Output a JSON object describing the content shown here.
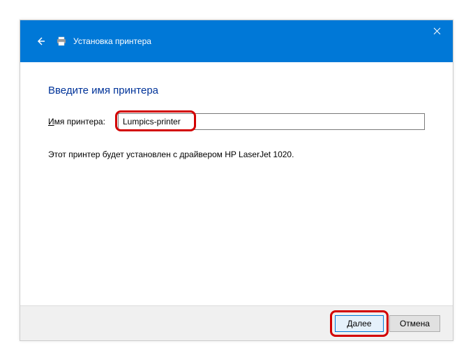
{
  "titlebar": {
    "title": "Установка принтера"
  },
  "content": {
    "heading": "Введите имя принтера",
    "field_label_prefix": "И",
    "field_label_rest": "мя принтера:",
    "input_value": "Lumpics-printer",
    "info_text": "Этот принтер будет установлен с драйвером HP LaserJet 1020."
  },
  "footer": {
    "next_prefix": "Д",
    "next_rest": "алее",
    "cancel": "Отмена"
  }
}
